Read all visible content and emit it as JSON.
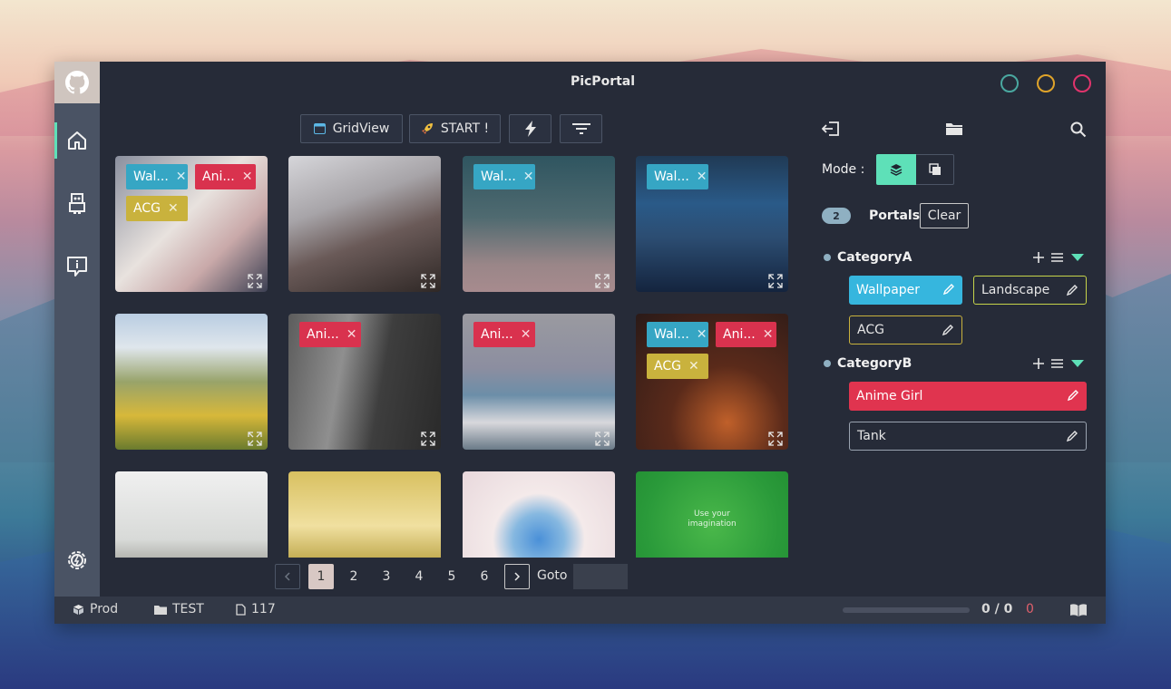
{
  "app": {
    "title": "PicPortal"
  },
  "toolbar": {
    "gridview_label": "GridView",
    "start_label": "START !"
  },
  "grid": {
    "cards": [
      {
        "tags": [
          {
            "label": "Wal...",
            "color": "#36a6c4"
          },
          {
            "label": "Ani...",
            "color": "#d9324e"
          },
          {
            "label": "ACG",
            "color": "#c9b23d"
          }
        ]
      },
      {
        "tags": []
      },
      {
        "tags": [
          {
            "label": "Wal...",
            "color": "#36a6c4"
          }
        ]
      },
      {
        "tags": [
          {
            "label": "Wal...",
            "color": "#36a6c4"
          }
        ]
      },
      {
        "tags": []
      },
      {
        "tags": [
          {
            "label": "Ani...",
            "color": "#d9324e"
          }
        ]
      },
      {
        "tags": [
          {
            "label": "Ani...",
            "color": "#d9324e"
          }
        ]
      },
      {
        "tags": [
          {
            "label": "Wal...",
            "color": "#36a6c4"
          },
          {
            "label": "Ani...",
            "color": "#d9324e"
          },
          {
            "label": "ACG",
            "color": "#c9b23d"
          }
        ]
      },
      {
        "tags": []
      },
      {
        "tags": []
      },
      {
        "tags": []
      },
      {
        "tags": [],
        "image_text": "Use your imagination"
      }
    ]
  },
  "pagination": {
    "current": "1",
    "pages": [
      "1",
      "2",
      "3",
      "4",
      "5",
      "6"
    ],
    "goto_label": "Goto",
    "goto_value": ""
  },
  "panel": {
    "mode_label": "Mode :",
    "portal_count": "2",
    "portals_label": "Portals",
    "clear_label": "Clear",
    "categories": [
      {
        "name": "CategoryA",
        "items": [
          {
            "label": "Wallpaper",
            "style": "filled",
            "color": "#36b6de"
          },
          {
            "label": "Landscape",
            "style": "outline",
            "color": "#c6d44a"
          },
          {
            "label": "ACG",
            "style": "outline",
            "color": "#c9b23d"
          }
        ]
      },
      {
        "name": "CategoryB",
        "items": [
          {
            "label": "Anime Girl",
            "style": "filled",
            "color": "#e0344f"
          },
          {
            "label": "Tank",
            "style": "outline",
            "color": "#9aa3b0"
          }
        ]
      }
    ]
  },
  "status": {
    "env": "Prod",
    "folder": "TEST",
    "file_count": "117",
    "progress_text": "0 / 0",
    "error_count": "0"
  },
  "colors": {
    "accent": "#5ee0b8",
    "window_bg": "#262b38",
    "winbtn_min": "#4aa8a0",
    "winbtn_max": "#e0a42a",
    "winbtn_close": "#e0346c"
  }
}
